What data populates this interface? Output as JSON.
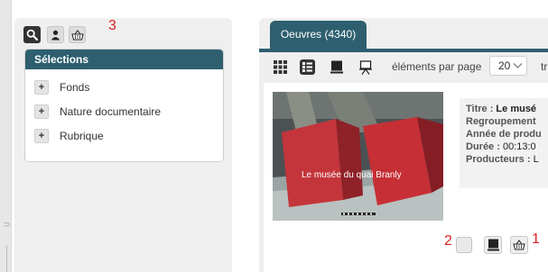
{
  "toolbar_icons": [
    "search-icon",
    "user-icon",
    "basket-icon"
  ],
  "annotations": {
    "a1": "1",
    "a2": "2",
    "a3": "3",
    "color": "#e02020"
  },
  "selections": {
    "header": "Sélections",
    "items": [
      {
        "label": "Fonds",
        "expander": "+"
      },
      {
        "label": "Nature documentaire",
        "expander": "+"
      },
      {
        "label": "Rubrique",
        "expander": "+"
      }
    ]
  },
  "results": {
    "tab_label": "Oeuvres (4340)",
    "view_icons": [
      "grid-view-icon",
      "list-view-icon",
      "detail-view-icon",
      "presentation-view-icon"
    ],
    "per_page_label": "éléments par page",
    "per_page_value": "20",
    "sort_label_partial": "tr",
    "item": {
      "thumbnail_caption": "Le musée du quai Branly",
      "fields": [
        {
          "key": "Titre :",
          "value": "Le musé",
          "bold_value": true
        },
        {
          "key": "Regroupement",
          "value": "",
          "bold_value": false
        },
        {
          "key": "Année de produ",
          "value": "",
          "bold_value": false
        },
        {
          "key": "Durée :",
          "value": "00:13:0",
          "bold_value": false
        },
        {
          "key": "Producteurs :",
          "value": "L",
          "bold_value": false
        }
      ]
    },
    "actions": [
      "select-checkbox",
      "document-icon",
      "basket-icon"
    ]
  },
  "colors": {
    "accent": "#2e5f6f",
    "panel_bg": "#efefef",
    "annotation": "#e02020"
  }
}
